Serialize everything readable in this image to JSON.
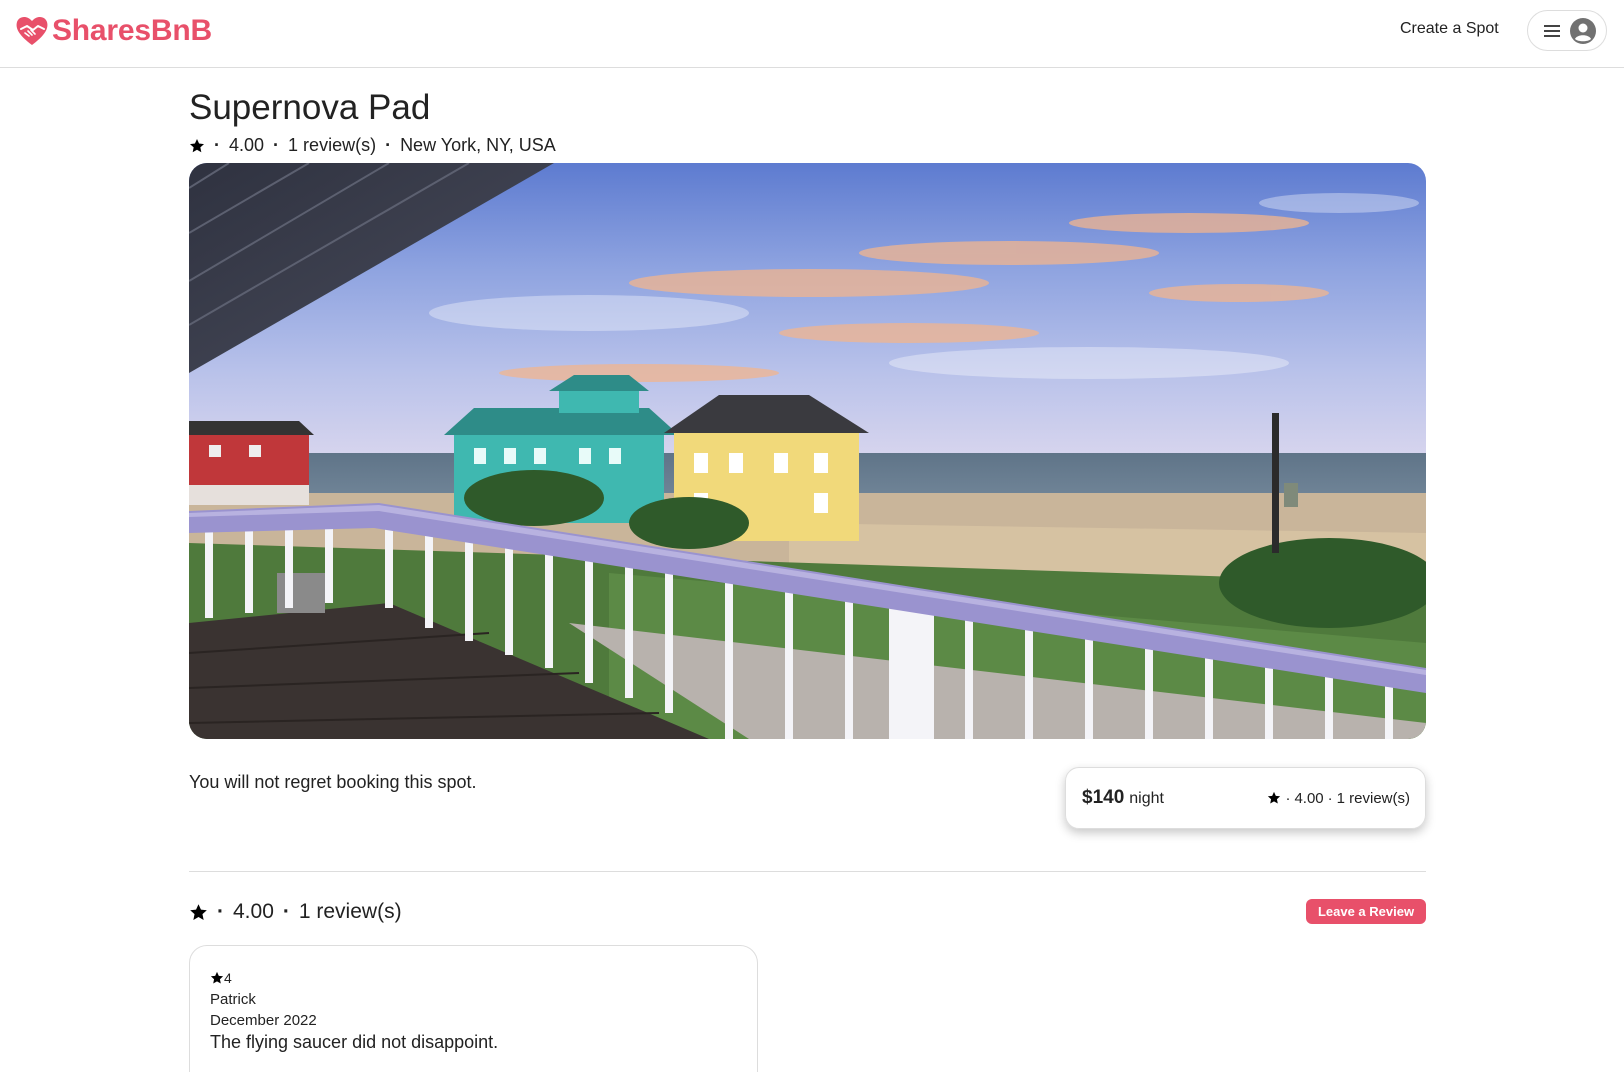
{
  "header": {
    "logo_text": "SharesBnB",
    "create_spot_label": "Create a Spot",
    "brand_color": "#e8506a"
  },
  "spot": {
    "title": "Supernova Pad",
    "rating": "4.00",
    "review_count": "1 review(s)",
    "location": "New York, NY, USA",
    "description": "You will not regret booking this spot.",
    "image_alt": "Beach houses viewed from a balcony at sunset"
  },
  "price_card": {
    "price": "$140",
    "unit": "night",
    "rating": "4.00",
    "review_count": "1 review(s)"
  },
  "reviews": {
    "rating": "4.00",
    "review_count": "1 review(s)",
    "leave_review_label": "Leave a Review",
    "items": [
      {
        "stars": "4",
        "author": "Patrick",
        "date": "December 2022",
        "text": "The flying saucer did not disappoint."
      }
    ]
  },
  "icons": {
    "logo": "heart-handshake-icon",
    "menu": "hamburger-menu-icon",
    "user": "user-circle-icon",
    "rating": "star-icon"
  }
}
